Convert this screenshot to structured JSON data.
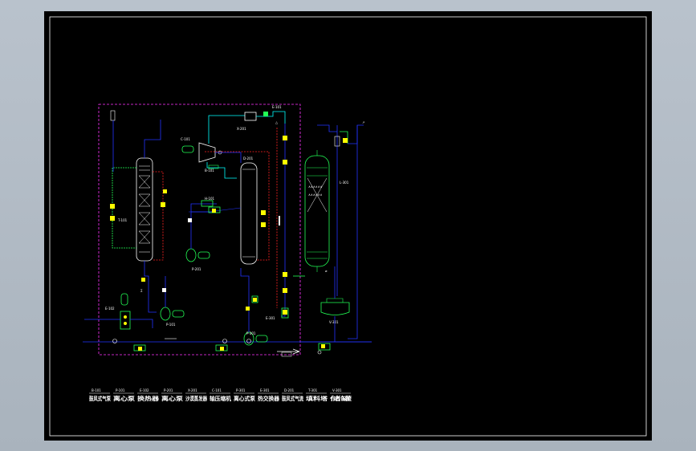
{
  "colors": {
    "background": "#b3bcc6",
    "canvas": "#000000",
    "border": "#ffffff",
    "process_line": "#2233ff",
    "steam_line": "#22ff55",
    "water_line": "#00ffff",
    "boundary": "#ff33ff",
    "hot_line": "#ff2222",
    "instrument": "#ffff00"
  },
  "equipment_tags": {
    "column_left": "T-101",
    "blower": "B-101",
    "pump_mid": "P-201",
    "compressor_top": "C-101",
    "cooler_top": "E-101",
    "heater_top": "X-201",
    "separator": "D-201",
    "tank_left": "E-102",
    "pump_left": "P-101",
    "pump_bottom": "P-301",
    "exchanger_right": "E-301",
    "column_right": "T-301",
    "receiver_right": "V-301",
    "line_right": "L-301",
    "heater_small": "H-101"
  },
  "legend": [
    {
      "code": "B-101",
      "name": "鼓风式气泵"
    },
    {
      "code": "P-101",
      "name": "离心泵"
    },
    {
      "code": "E-102",
      "name": "换热器"
    },
    {
      "code": "P-201",
      "name": "离心泵"
    },
    {
      "code": "X-201",
      "name": "沙漠蒸发器"
    },
    {
      "code": "C-101",
      "name": "轴压缩机"
    },
    {
      "code": "P-301",
      "name": "离心式泵"
    },
    {
      "code": "E-301",
      "name": "热交换器"
    },
    {
      "code": "D-201",
      "name": "鼓风式气流"
    },
    {
      "code": "T-301",
      "name": "填料塔"
    },
    {
      "code": "V-301",
      "name": "储罐"
    }
  ]
}
